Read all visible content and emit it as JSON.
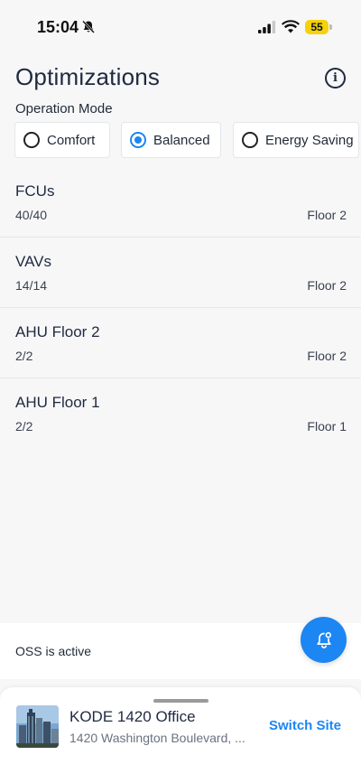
{
  "status_bar": {
    "time": "15:04",
    "battery": "55",
    "icons": [
      "bell-slash-icon",
      "signal-icon",
      "wifi-icon",
      "battery-icon"
    ]
  },
  "header": {
    "title": "Optimizations",
    "info_icon": "info-icon"
  },
  "operation_mode": {
    "label": "Operation Mode",
    "options": [
      {
        "label": "Comfort",
        "selected": false
      },
      {
        "label": "Balanced",
        "selected": true
      },
      {
        "label": "Energy Saving",
        "selected": false
      }
    ]
  },
  "equipment": [
    {
      "name": "FCUs",
      "count": "40/40",
      "floor": "Floor 2"
    },
    {
      "name": "VAVs",
      "count": "14/14",
      "floor": "Floor 2"
    },
    {
      "name": "AHU Floor 2",
      "count": "2/2",
      "floor": "Floor 2"
    },
    {
      "name": "AHU Floor 1",
      "count": "2/2",
      "floor": "Floor 1"
    }
  ],
  "oss": {
    "status_text": "OSS is active",
    "notify_icon": "bell-icon"
  },
  "site": {
    "name": "KODE 1420 Office",
    "address": "1420 Washington Boulevard, ...",
    "switch_label": "Switch Site"
  },
  "colors": {
    "accent": "#1c86f2",
    "background": "#f7f7f8",
    "battery": "#f5d20a"
  }
}
